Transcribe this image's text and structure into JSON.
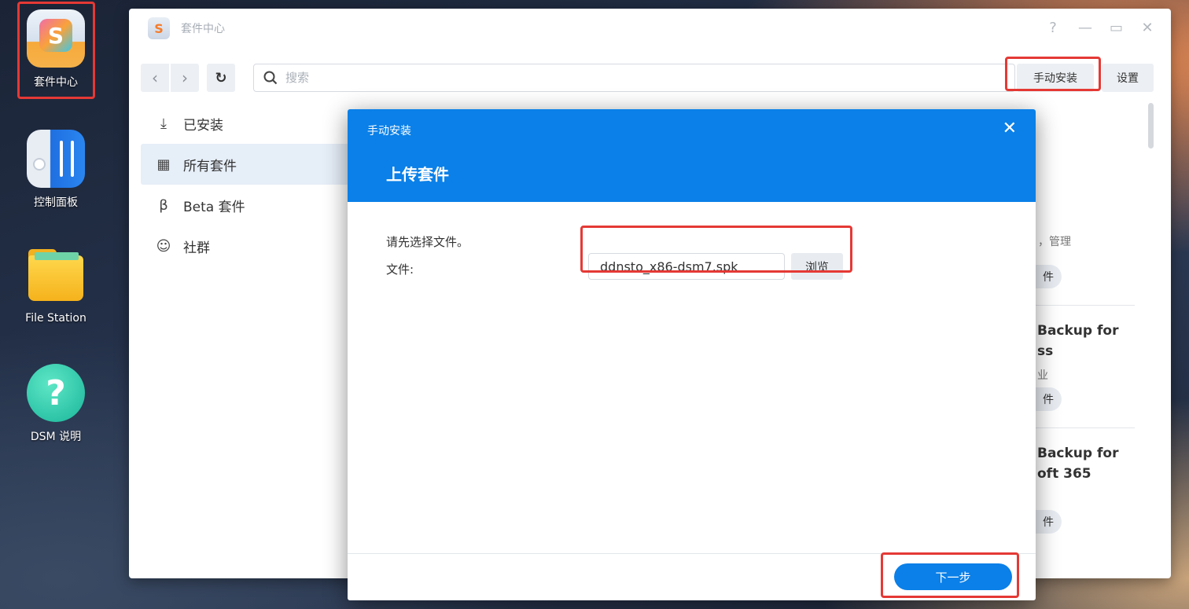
{
  "desktop": {
    "icons": [
      {
        "label": "套件中心"
      },
      {
        "label": "控制面板"
      },
      {
        "label": "File Station"
      },
      {
        "label": "DSM 说明"
      }
    ]
  },
  "window": {
    "title": "套件中心",
    "controls": {
      "help": "?",
      "minimize": "—",
      "maximize": "▭",
      "close": "✕"
    },
    "toolbar": {
      "search_placeholder": "搜索",
      "manual_install": "手动安装",
      "settings": "设置"
    },
    "sidebar": {
      "items": [
        {
          "label": "已安装"
        },
        {
          "label": "所有套件"
        },
        {
          "label": "Beta 套件"
        },
        {
          "label": "社群"
        }
      ]
    },
    "partial_cards": [
      {
        "line1": "，管理",
        "action": "件"
      },
      {
        "line1": "Backup for",
        "line2": "ss",
        "line3": "业",
        "action": "件"
      },
      {
        "line1": "Backup for",
        "line2": "oft 365",
        "action": "件"
      }
    ]
  },
  "modal": {
    "header_small": "手动安装",
    "header_title": "上传套件",
    "hint": "请先选择文件。",
    "file_label": "文件:",
    "file_value": "ddnsto_x86-dsm7.spk",
    "browse": "浏览",
    "next": "下一步"
  },
  "colors": {
    "accent": "#0a80e8",
    "highlight": "#e53935"
  }
}
